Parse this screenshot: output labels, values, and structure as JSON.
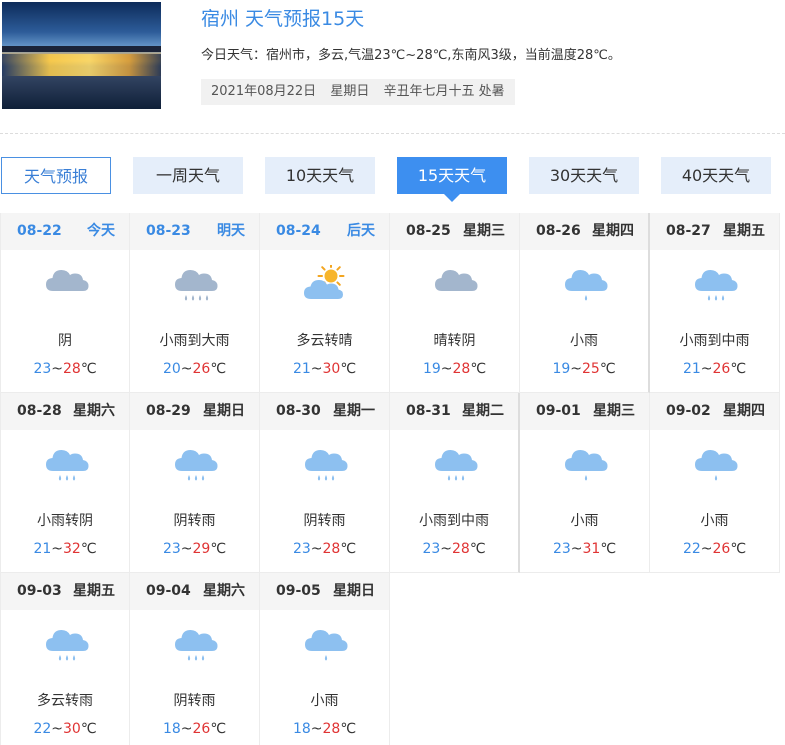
{
  "header": {
    "title": "宿州 天气预报15天",
    "today": "今日天气：宿州市，多云,气温23℃~28℃,东南风3级，当前温度28℃。",
    "date": "2021年08月22日",
    "weekday": "星期日",
    "lunar": "辛丑年七月十五 处暑"
  },
  "tabs": [
    {
      "label": "天气预报",
      "state": "outline"
    },
    {
      "label": "一周天气",
      "state": "normal"
    },
    {
      "label": "10天天气",
      "state": "normal"
    },
    {
      "label": "15天天气",
      "state": "active"
    },
    {
      "label": "30天天气",
      "state": "normal"
    },
    {
      "label": "40天天气",
      "state": "normal"
    }
  ],
  "temp_unit": "℃",
  "days": [
    {
      "date": "08-22",
      "week": "今天",
      "desc": "阴",
      "low": "23",
      "high": "28",
      "icon": "cloud"
    },
    {
      "date": "08-23",
      "week": "明天",
      "desc": "小雨到大雨",
      "low": "20",
      "high": "26",
      "icon": "heavy-rain"
    },
    {
      "date": "08-24",
      "week": "后天",
      "desc": "多云转晴",
      "low": "21",
      "high": "30",
      "icon": "partly-sunny"
    },
    {
      "date": "08-25",
      "week": "星期三",
      "desc": "晴转阴",
      "low": "19",
      "high": "28",
      "icon": "cloud"
    },
    {
      "date": "08-26",
      "week": "星期四",
      "desc": "小雨",
      "low": "19",
      "high": "25",
      "icon": "light-rain"
    },
    {
      "date": "08-27",
      "week": "星期五",
      "desc": "小雨到中雨",
      "low": "21",
      "high": "26",
      "icon": "rain"
    },
    {
      "date": "08-28",
      "week": "星期六",
      "desc": "小雨转阴",
      "low": "21",
      "high": "32",
      "icon": "rain"
    },
    {
      "date": "08-29",
      "week": "星期日",
      "desc": "阴转雨",
      "low": "23",
      "high": "29",
      "icon": "rain"
    },
    {
      "date": "08-30",
      "week": "星期一",
      "desc": "阴转雨",
      "low": "23",
      "high": "28",
      "icon": "rain"
    },
    {
      "date": "08-31",
      "week": "星期二",
      "desc": "小雨到中雨",
      "low": "23",
      "high": "28",
      "icon": "rain"
    },
    {
      "date": "09-01",
      "week": "星期三",
      "desc": "小雨",
      "low": "23",
      "high": "31",
      "icon": "light-rain"
    },
    {
      "date": "09-02",
      "week": "星期四",
      "desc": "小雨",
      "low": "22",
      "high": "26",
      "icon": "light-rain"
    },
    {
      "date": "09-03",
      "week": "星期五",
      "desc": "多云转雨",
      "low": "22",
      "high": "30",
      "icon": "rain"
    },
    {
      "date": "09-04",
      "week": "星期六",
      "desc": "阴转雨",
      "low": "18",
      "high": "26",
      "icon": "rain"
    },
    {
      "date": "09-05",
      "week": "星期日",
      "desc": "小雨",
      "low": "18",
      "high": "28",
      "icon": "light-rain"
    }
  ],
  "colors": {
    "accent": "#3a8ae3",
    "low_temp": "#3a8ae3",
    "high_temp": "#e03434",
    "tab_active": "#3d8ff0",
    "tab_bg": "#e5eefa",
    "cloud_gray": "#a3b6cd",
    "cloud_blue": "#8dc0f0"
  }
}
